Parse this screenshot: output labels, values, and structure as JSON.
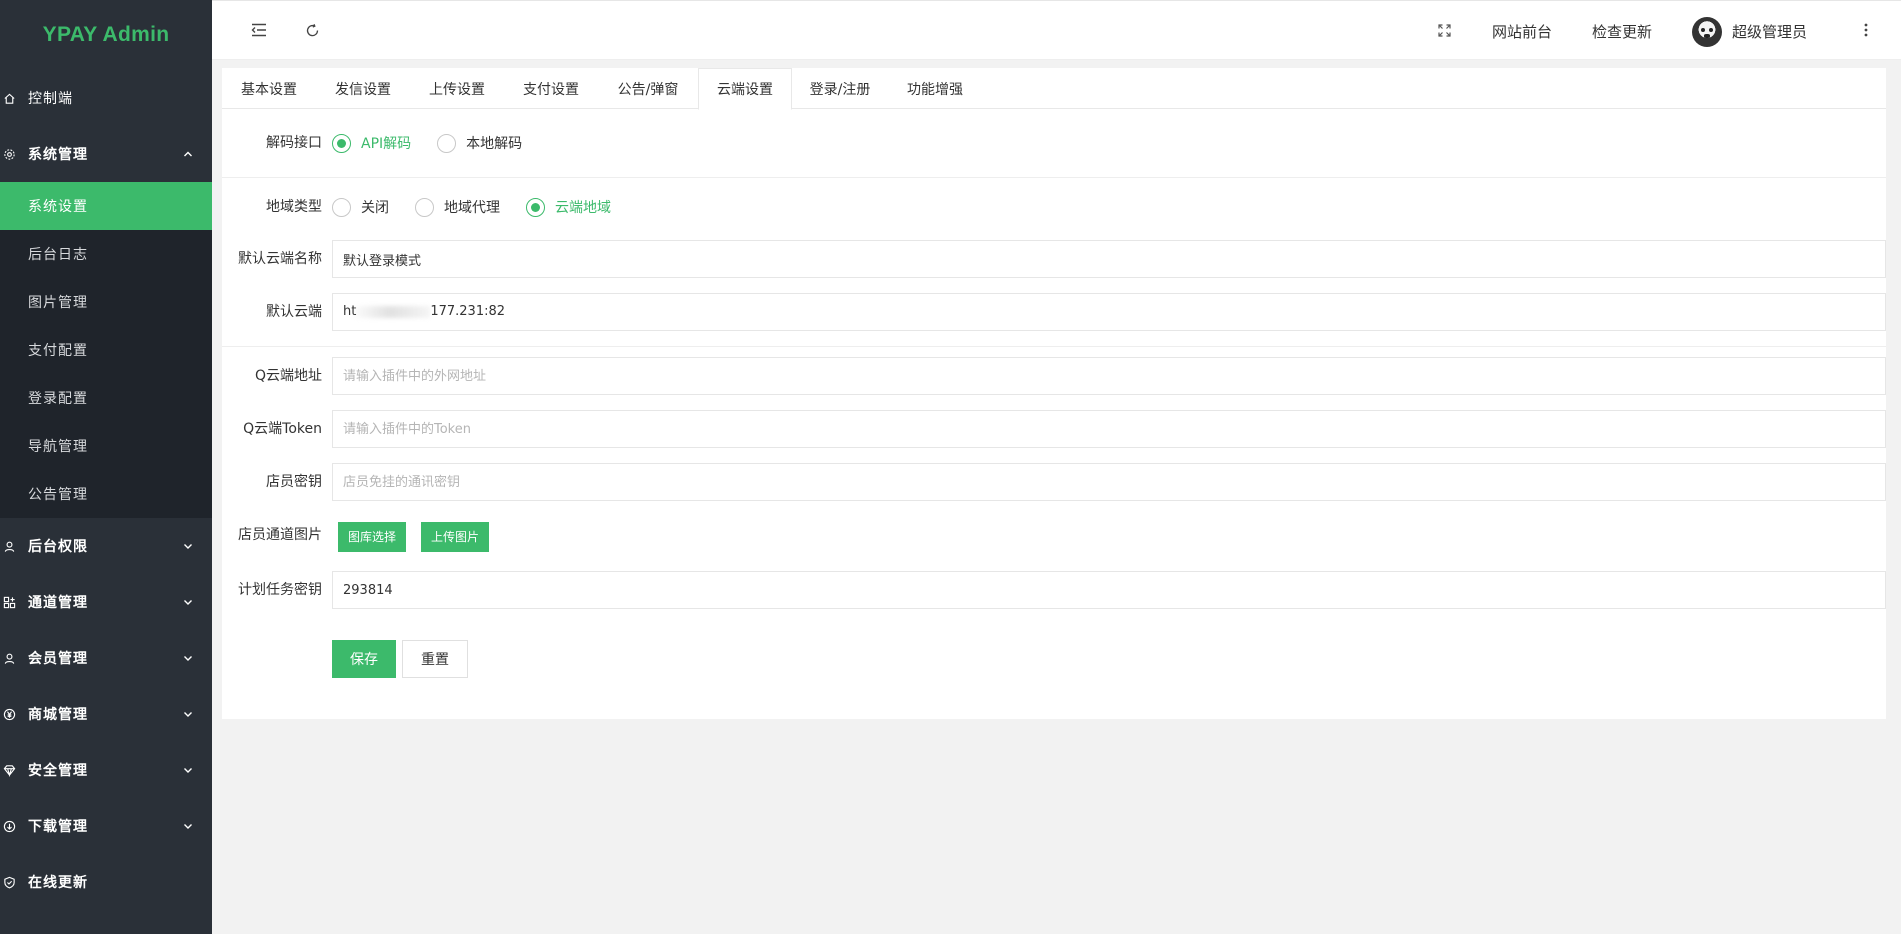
{
  "app": {
    "title": "YPAY Admin",
    "accent": "#3cba6b",
    "sidebar_bg": "#2a3038"
  },
  "sidebar": {
    "items": [
      {
        "label": "控制端",
        "icon": "home-icon"
      },
      {
        "label": "系统管理",
        "icon": "gear-icon",
        "expanded": true
      },
      {
        "label": "后台权限",
        "icon": "user-icon"
      },
      {
        "label": "通道管理",
        "icon": "apps-icon"
      },
      {
        "label": "会员管理",
        "icon": "user-icon"
      },
      {
        "label": "商城管理",
        "icon": "yen-icon"
      },
      {
        "label": "安全管理",
        "icon": "diamond-icon"
      },
      {
        "label": "下载管理",
        "icon": "download-icon"
      },
      {
        "label": "在线更新",
        "icon": "shield-icon"
      }
    ],
    "sub_items": [
      "系统设置",
      "后台日志",
      "图片管理",
      "支付配置",
      "登录配置",
      "导航管理",
      "公告管理"
    ],
    "active_sub": "系统设置"
  },
  "header": {
    "links": [
      "网站前台",
      "检查更新"
    ],
    "user": "超级管理员",
    "icons": [
      "menu-fold-icon",
      "refresh-icon",
      "fullscreen-icon",
      "more-vertical-icon"
    ]
  },
  "tabs": [
    "基本设置",
    "发信设置",
    "上传设置",
    "支付设置",
    "公告/弹窗",
    "云端设置",
    "登录/注册",
    "功能增强"
  ],
  "active_tab": "云端设置",
  "form": {
    "decode": {
      "label": "解码接口",
      "options": [
        "API解码",
        "本地解码"
      ],
      "selected": "API解码"
    },
    "region": {
      "label": "地域类型",
      "options": [
        "关闭",
        "地域代理",
        "云端地域"
      ],
      "selected": "云端地域"
    },
    "default_cloud_name": {
      "label": "默认云端名称",
      "value": "默认登录模式"
    },
    "default_cloud": {
      "label": "默认云端",
      "value_prefix": "ht",
      "value_suffix": "177.231:82"
    },
    "q_cloud_addr": {
      "label": "Q云端地址",
      "placeholder": "请输入插件中的外网地址"
    },
    "q_cloud_token": {
      "label": "Q云端Token",
      "placeholder": "请输入插件中的Token"
    },
    "clerk_key": {
      "label": "店员密钥",
      "placeholder": "店员免挂的通讯密钥"
    },
    "clerk_image": {
      "label": "店员通道图片",
      "btn_gallery": "图库选择",
      "btn_upload": "上传图片"
    },
    "cron_key": {
      "label": "计划任务密钥",
      "value": "293814"
    },
    "save": "保存",
    "reset": "重置"
  }
}
